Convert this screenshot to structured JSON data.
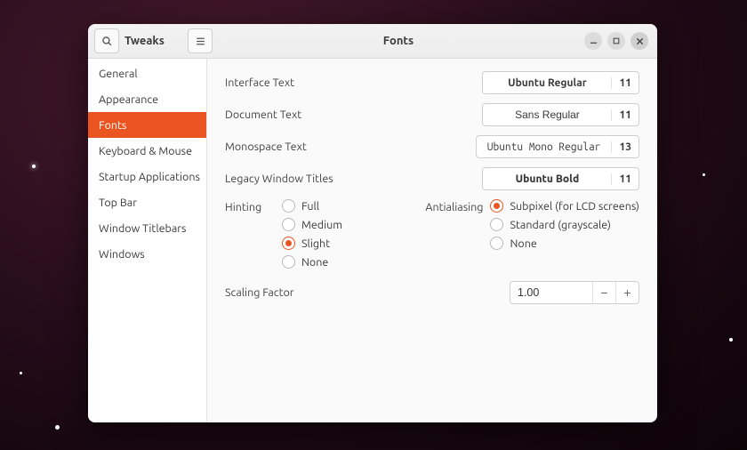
{
  "window": {
    "app_title": "Tweaks",
    "page_title": "Fonts"
  },
  "sidebar": {
    "items": [
      {
        "label": "General"
      },
      {
        "label": "Appearance"
      },
      {
        "label": "Fonts",
        "active": true
      },
      {
        "label": "Keyboard & Mouse"
      },
      {
        "label": "Startup Applications"
      },
      {
        "label": "Top Bar"
      },
      {
        "label": "Window Titlebars"
      },
      {
        "label": "Windows"
      }
    ]
  },
  "fonts": {
    "rows": [
      {
        "label": "Interface Text",
        "font": "Ubuntu Regular",
        "size": "11"
      },
      {
        "label": "Document Text",
        "font": "Sans Regular",
        "size": "11"
      },
      {
        "label": "Monospace Text",
        "font": "Ubuntu Mono Regular",
        "size": "13"
      },
      {
        "label": "Legacy Window Titles",
        "font": "Ubuntu Bold",
        "size": "11"
      }
    ]
  },
  "hinting": {
    "label": "Hinting",
    "options": [
      "Full",
      "Medium",
      "Slight",
      "None"
    ],
    "selected": "Slight"
  },
  "antialiasing": {
    "label": "Antialiasing",
    "options": [
      "Subpixel (for LCD screens)",
      "Standard (grayscale)",
      "None"
    ],
    "selected": "Subpixel (for LCD screens)"
  },
  "scaling": {
    "label": "Scaling Factor",
    "value": "1.00"
  }
}
